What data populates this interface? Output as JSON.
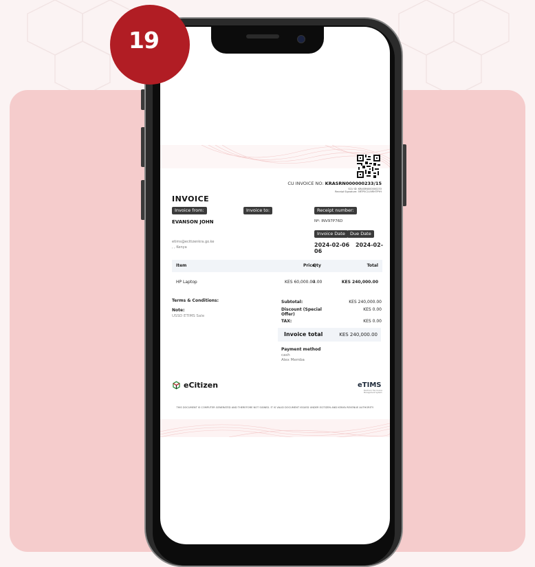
{
  "badge": {
    "number": "19"
  },
  "invoice": {
    "cu_label": "CU INVOICE NO:",
    "cu_number": "KRASRN000000233/15",
    "scu_id": "SCU ID: KRASRN000000233",
    "receipt_signature": "Receipt Signature: 5RTP5C1UVRHTPYH",
    "title": "INVOICE",
    "tags": {
      "from": "Invoice from:",
      "to": "Invoice to:",
      "receipt": "Receipt number:",
      "invoice_date": "Invoice Date",
      "due_date": "Due Date"
    },
    "from_name": "EVANSON JOHN",
    "receipt_number": "Nº: INV97P76D",
    "invoice_date": "2024-02-06",
    "due_date": "2024-02-06",
    "from_email": "etims@ecitizenkra.go.ke",
    "from_location": ", , Kenya",
    "table": {
      "headers": {
        "item": "Item",
        "price": "Price",
        "qty": "Qty",
        "total": "Total"
      },
      "rows": [
        {
          "item": "HP Laptop",
          "price": "KES 60,000.00",
          "qty": "4.00",
          "total": "KES 240,000.00"
        }
      ]
    },
    "terms_label": "Terms & Conditions:",
    "note_label": "Note:",
    "note_value": "USSD ETIMS Sale",
    "summary": {
      "subtotal_label": "Subtotal:",
      "subtotal_value": "KES 240,000.00",
      "discount_label": "Discount (Special Offer)",
      "discount_value": "KES 0.00",
      "tax_label": "TAX:",
      "tax_value": "KES 0.00",
      "total_label": "Invoice total",
      "total_value": "KES 240,000.00"
    },
    "payment": {
      "label": "Payment method",
      "method": "cash",
      "payer": "Alex Memba"
    },
    "brand_left": "eCitizen",
    "brand_right": "eTIMS",
    "brand_right_sub": "Electronic Tax Invoice Management System",
    "footer": "THIS DOCUMENT IS COMPUTER GENERATED AND THEREFORE NOT SIGNED. IT IS VALID DOCUMENT ISSUED UNDER ECITIZEN AND KENYA REVENUE AUTHORITY."
  },
  "colors": {
    "badge": "#b11d24",
    "panel": "#f5cccc",
    "background": "#fbf3f3",
    "tag": "#3b3b3b",
    "table_header": "#f1f4f8",
    "etims_accent": "#c0272d"
  },
  "icons": [
    "ecitizen-logo-icon",
    "qr-code-icon",
    "camera-icon"
  ]
}
